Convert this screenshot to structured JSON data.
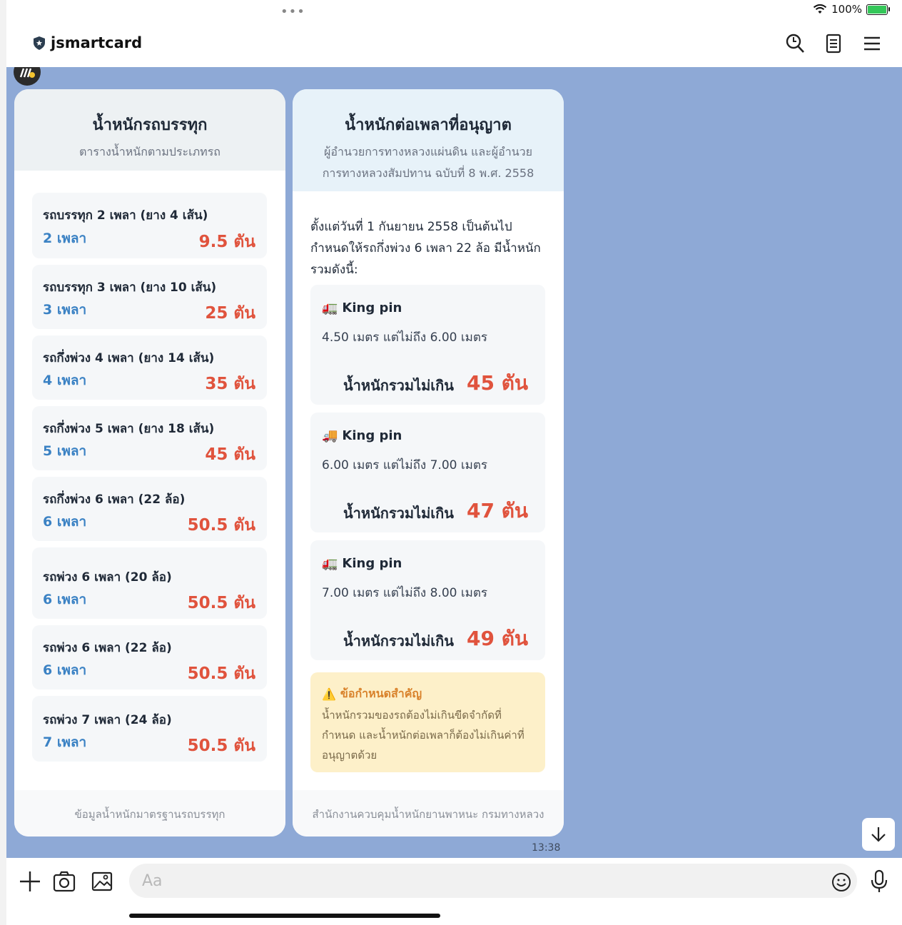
{
  "status": {
    "battery_text": "100%"
  },
  "header": {
    "title": "jsmartcard"
  },
  "colors": {
    "chat_bg": "#8ea9d6",
    "accent_red": "#e0533d",
    "accent_blue": "#3b82c4",
    "note_bg": "#fdf0c9"
  },
  "card1": {
    "title": "น้ำหนักรถบรรทุก",
    "subtitle": "ตารางน้ำหนักตามประเภทรถ",
    "vehicles": [
      {
        "name": "รถบรรทุก 2 เพลา (ยาง 4 เส้น)",
        "axles": "2 เพลา",
        "weight": "9.5 ตัน"
      },
      {
        "name": "รถบรรทุก 3 เพลา (ยาง 10 เส้น)",
        "axles": "3 เพลา",
        "weight": "25 ตัน"
      },
      {
        "name": "รถกึ่งพ่วง 4 เพลา (ยาง 14 เส้น)",
        "axles": "4 เพลา",
        "weight": "35 ตัน"
      },
      {
        "name": "รถกึ่งพ่วง 5 เพลา (ยาง 18 เส้น)",
        "axles": "5 เพลา",
        "weight": "45 ตัน"
      },
      {
        "name": "รถกึ่งพ่วง 6 เพลา (22 ล้อ)",
        "axles": "6 เพลา",
        "weight": "50.5 ตัน"
      },
      {
        "name": "รถพ่วง 6 เพลา (20 ล้อ)",
        "axles": "6 เพลา",
        "weight": "50.5 ตัน"
      },
      {
        "name": "รถพ่วง 6 เพลา (22 ล้อ)",
        "axles": "6 เพลา",
        "weight": "50.5 ตัน"
      },
      {
        "name": "รถพ่วง 7 เพลา (24 ล้อ)",
        "axles": "7 เพลา",
        "weight": "50.5 ตัน"
      }
    ],
    "footer": "ข้อมูลน้ำหนักมาตรฐานรถบรรทุก"
  },
  "card2": {
    "title": "น้ำหนักต่อเพลาที่อนุญาต",
    "subtitle_line1": "ผู้อำนวยการทางหลวงแผ่นดิน และผู้อำนวย",
    "subtitle_line2": "การทางหลวงสัมปทาน ฉบับที่ 8 พ.ศ. 2558",
    "intro": "ตั้งแต่วันที่ 1 กันยายน 2558 เป็นต้นไป กำหนดให้รถกึ่งพ่วง 6 เพลา 22 ล้อ มีน้ำหนักรวมดังนี้:",
    "kingpins": [
      {
        "icon": "🚛",
        "label": "King pin",
        "range": "4.50 เมตร แต่ไม่ถึง 6.00 เมตร",
        "limit_label": "น้ำหนักรวมไม่เกิน",
        "limit_value": "45 ตัน"
      },
      {
        "icon": "🚚",
        "label": "King pin",
        "range": "6.00 เมตร แต่ไม่ถึง 7.00 เมตร",
        "limit_label": "น้ำหนักรวมไม่เกิน",
        "limit_value": "47 ตัน"
      },
      {
        "icon": "🚛",
        "label": "King pin",
        "range": "7.00 เมตร แต่ไม่ถึง 8.00 เมตร",
        "limit_label": "น้ำหนักรวมไม่เกิน",
        "limit_value": "49 ตัน"
      }
    ],
    "note": {
      "icon": "⚠️",
      "title": "ข้อกำหนดสำคัญ",
      "body": "น้ำหนักรวมของรถต้องไม่เกินขีดจำกัดที่กำหนด และน้ำหนักต่อเพลาก็ต้องไม่เกินค่าที่อนุญาตด้วย"
    },
    "footer": "สำนักงานควบคุมน้ำหนักยานพาหนะ กรมทางหลวง"
  },
  "message_time": "13:38",
  "composer": {
    "placeholder": "Aa"
  }
}
